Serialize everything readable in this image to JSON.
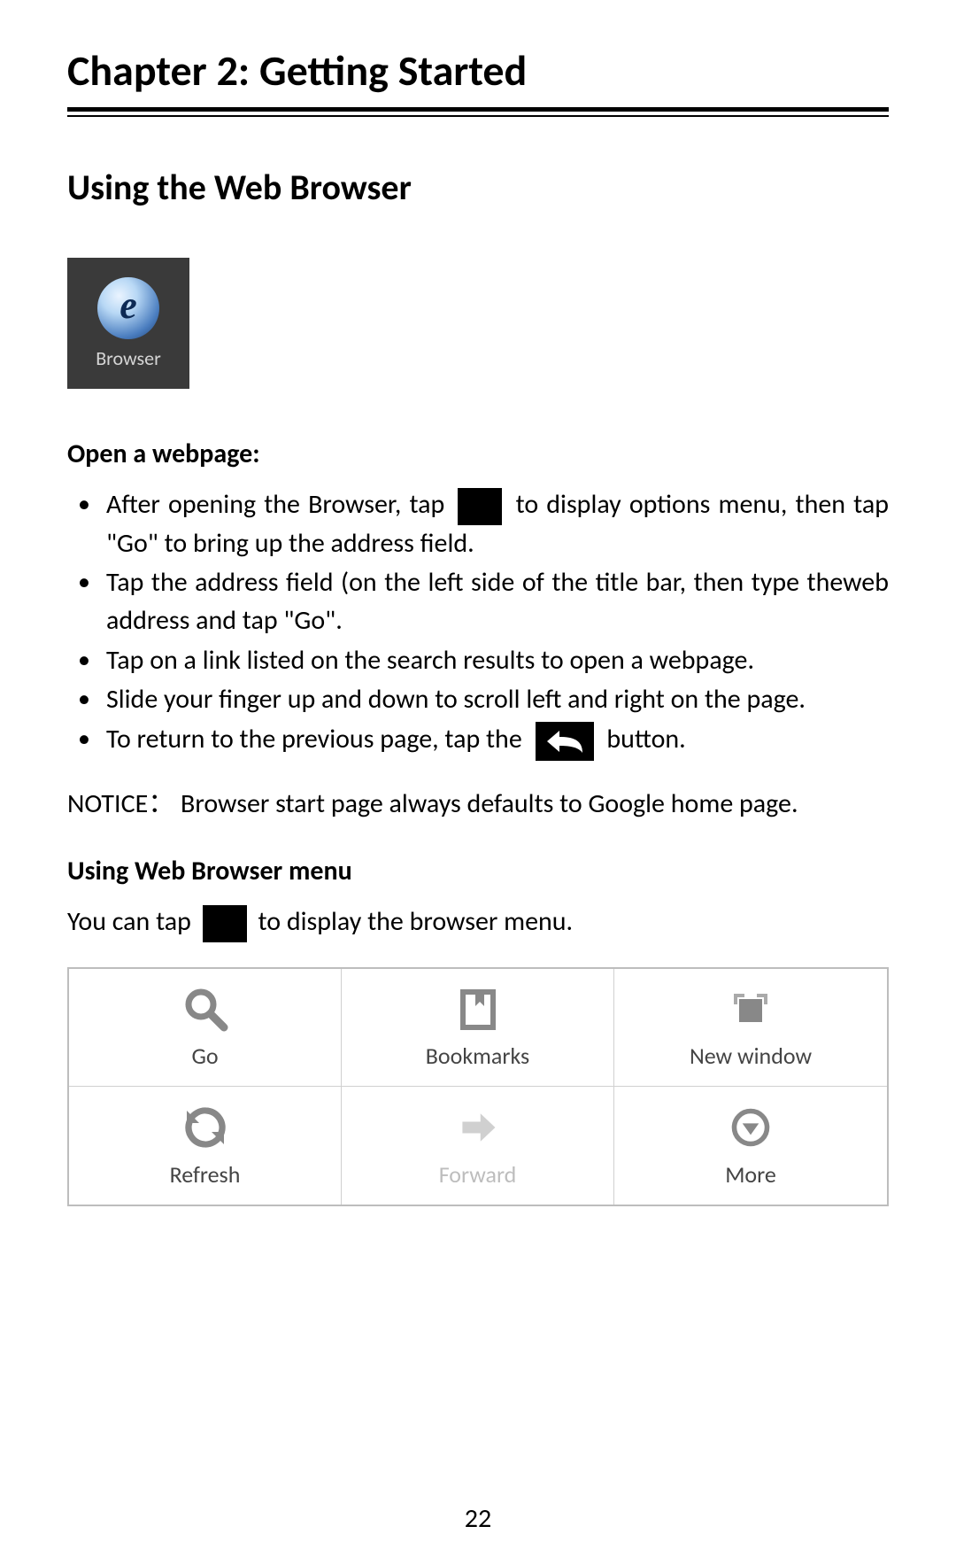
{
  "chapter_title": "Chapter 2: Getting Started",
  "section_title": "Using the Web Browser",
  "browser_tile_label": "Browser",
  "subhead_open": "Open a webpage:",
  "bullets": {
    "b1_a": "After opening the Browser, tap",
    "b1_b": "to display options menu, then tap \"Go\" to bring up the address field.",
    "b2": "Tap the address field (on the left side of the title bar, then type theweb address and tap \"Go\".",
    "b3": "Tap on a link listed on the search results to open a webpage.",
    "b4": "Slide your finger up and down to scroll left and right on the page.",
    "b5_a": "To return to the previous page, tap the",
    "b5_b": "button."
  },
  "notice": "NOTICE： Browser start page always defaults to Google home page.",
  "subhead_menu": "Using Web Browser menu",
  "menu_line_a": "You can tap",
  "menu_line_b": "to display the browser menu.",
  "menu_items": {
    "go": "Go",
    "bookmarks": "Bookmarks",
    "new_window": "New window",
    "refresh": "Refresh",
    "forward": "Forward",
    "more": "More"
  },
  "page_number": "22"
}
